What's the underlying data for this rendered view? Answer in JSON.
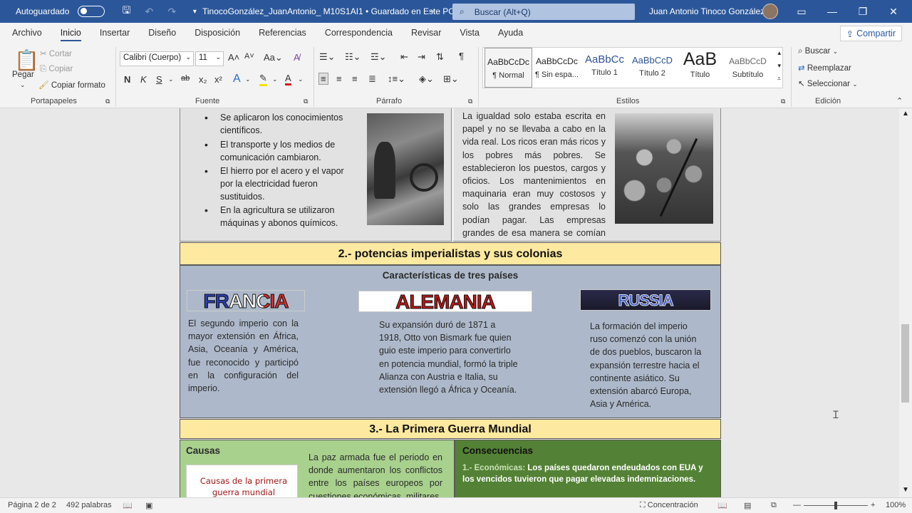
{
  "titlebar": {
    "autosave_label": "Autoguardado",
    "doc_title": "TinocoGonzález_JuanAntonio_ M10S1AI1 • Guardado en Este PC",
    "search_placeholder": "Buscar (Alt+Q)",
    "user_name": "Juan Antonio Tinoco González"
  },
  "menu": {
    "items": [
      "Archivo",
      "Inicio",
      "Insertar",
      "Diseño",
      "Disposición",
      "Referencias",
      "Correspondencia",
      "Revisar",
      "Vista",
      "Ayuda"
    ],
    "share": "Compartir"
  },
  "ribbon": {
    "clipboard": {
      "paste": "Pegar",
      "cut": "Cortar",
      "copy": "Copiar",
      "format_painter": "Copiar formato",
      "label": "Portapapeles"
    },
    "font": {
      "family": "Calibri (Cuerpo)",
      "size": "11",
      "bold": "N",
      "italic": "K",
      "underline": "S",
      "label": "Fuente"
    },
    "paragraph": {
      "label": "Párrafo"
    },
    "styles": {
      "label": "Estilos",
      "tiles": [
        {
          "preview": "AaBbCcDc",
          "name": "¶ Normal"
        },
        {
          "preview": "AaBbCcDc",
          "name": "¶ Sin espa..."
        },
        {
          "preview": "AaBbCc",
          "name": "Título 1"
        },
        {
          "preview": "AaBbCcD",
          "name": "Título 2"
        },
        {
          "preview": "AaB",
          "name": "Título"
        },
        {
          "preview": "AaBbCcD",
          "name": "Subtítulo"
        }
      ]
    },
    "editing": {
      "find": "Buscar",
      "replace": "Reemplazar",
      "select": "Seleccionar",
      "label": "Edición"
    }
  },
  "document": {
    "bullets": [
      "Se aplicaron los conocimientos científicos.",
      "El transporte y los medios de comunicación cambiaron.",
      "El hierro por el acero y el vapor por la electricidad fueron sustituidos.",
      "En la agricultura se utilizaron máquinas y abonos químicos."
    ],
    "equality_text": "La igualdad solo estaba escrita en papel y no se llevaba a cabo en la vida real. Los ricos eran más ricos y los pobres más pobres. Se establecieron los puestos, cargos y oficios. Los mantenimientos en maquinaria eran muy costosos y solo las grandes empresas lo podían pagar. Las empresas grandes de esa manera se comían a las pequeñas.",
    "section2_title": "2.- potencias imperialistas y sus colonias",
    "section2_subtitle": "Características de tres países",
    "countries": [
      {
        "name": "FRANCIA",
        "text": "El segundo imperio con la mayor extensión en África, Asia, Oceanía y América, fue reconocido y participó en la configuración del imperio."
      },
      {
        "name": "ALEMANIA",
        "text": "Su expansión duró de 1871 a 1918, Otto von Bismark fue quien guio este imperio para convertirlo en potencia mundial, formó la triple Alianza con Austria e Italia, su extensión llegó a África y Oceanía."
      },
      {
        "name": "RUSSIA",
        "text": "La formación del imperio ruso comenzó con la unión de dos pueblos, buscaron la expansión terrestre hacia el continente asiático. Su extensión abarcó Europa, Asia y América."
      }
    ],
    "section3_title": "3.- La Primera Guerra Mundial",
    "causes_heading": "Causas",
    "causes_card": "Causas de la primera guerra mundial",
    "causes_text": "La paz armada fue el periodo en donde aumentaron los conflictos entre los países europeos por cuestiones económicas, militares",
    "consequences_heading": "Consecuencias",
    "econ_label": "1.- Económicas:",
    "econ_text": "Los países quedaron endeudados con EUA y los vencidos tuvieron que pagar elevadas indemnizaciones."
  },
  "status": {
    "page": "Página 2 de 2",
    "words": "492 palabras",
    "focus": "Concentración",
    "zoom": "100%"
  },
  "colors": {
    "word_blue": "#2b579a",
    "banner_yellow": "#fde9a0",
    "section_gray_blue": "#adb9ca",
    "causes_green": "#a9d18e",
    "consequences_green": "#538135"
  }
}
